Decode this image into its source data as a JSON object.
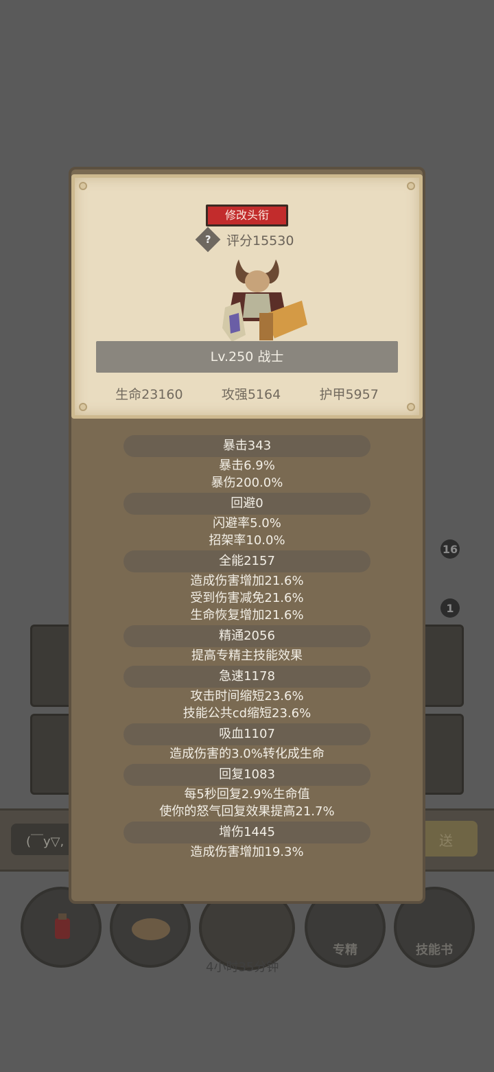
{
  "background": {
    "chat_hint": "(￣y▽,",
    "send_label": "送",
    "badge_top": "16",
    "badge_bottom": "1",
    "timer": "4小时35分钟",
    "nav": {
      "specialization_label": "专精",
      "skill_book_label": "技能书"
    }
  },
  "profile": {
    "edit_title_label": "修改头衔",
    "help_glyph": "?",
    "score": "评分15530",
    "level_class": "Lv.250 战士",
    "hp": "生命23160",
    "attack": "攻强5164",
    "armor": "护甲5957"
  },
  "stats": [
    {
      "title": "暴击343",
      "lines": [
        "暴击6.9%",
        "暴伤200.0%"
      ]
    },
    {
      "title": "回避0",
      "lines": [
        "闪避率5.0%",
        "招架率10.0%"
      ]
    },
    {
      "title": "全能2157",
      "lines": [
        "造成伤害增加21.6%",
        "受到伤害减免21.6%",
        "生命恢复增加21.6%"
      ]
    },
    {
      "title": "精通2056",
      "lines": [
        "提高专精主技能效果"
      ]
    },
    {
      "title": "急速1178",
      "lines": [
        "攻击时间缩短23.6%",
        "技能公共cd缩短23.6%"
      ]
    },
    {
      "title": "吸血1107",
      "lines": [
        "造成伤害的3.0%转化成生命"
      ]
    },
    {
      "title": "回复1083",
      "lines": [
        "每5秒回复2.9%生命值",
        "使你的怒气回复效果提高21.7%"
      ]
    },
    {
      "title": "增伤1445",
      "lines": [
        "造成伤害增加19.3%"
      ]
    }
  ],
  "colors": {
    "title_button": "#c22c2c",
    "panel": "#7a6a52",
    "parchment": "#e9dcc0"
  }
}
